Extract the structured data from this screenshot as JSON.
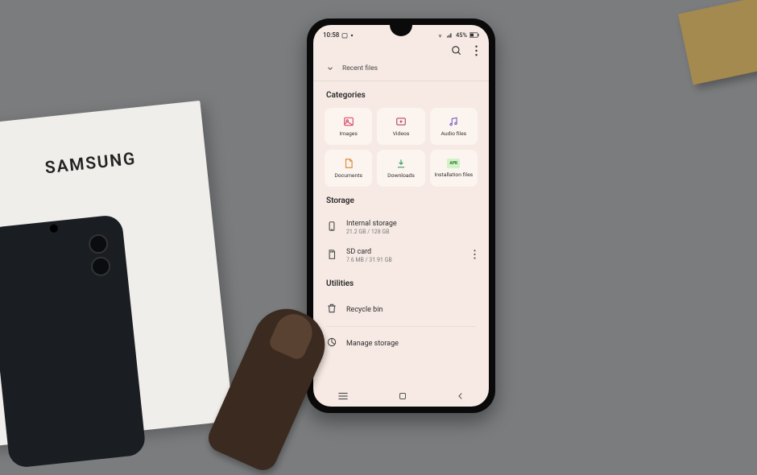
{
  "box": {
    "brand": "SAMSUNG"
  },
  "status": {
    "time": "10:58",
    "battery": "45%"
  },
  "header": {
    "recent": "Recent files"
  },
  "sections": {
    "categories": "Categories",
    "storage": "Storage",
    "utilities": "Utilities"
  },
  "cats": {
    "images": "Images",
    "videos": "Videos",
    "audio": "Audio files",
    "documents": "Documents",
    "downloads": "Downloads",
    "install": "Installation files",
    "apk": "APK"
  },
  "storage": {
    "internal": {
      "label": "Internal storage",
      "sub": "21.2 GB / 128 GB"
    },
    "sd": {
      "label": "SD card",
      "sub": "7.6 MB / 31.91 GB"
    }
  },
  "utilities": {
    "recycle": "Recycle bin",
    "manage": "Manage storage"
  }
}
